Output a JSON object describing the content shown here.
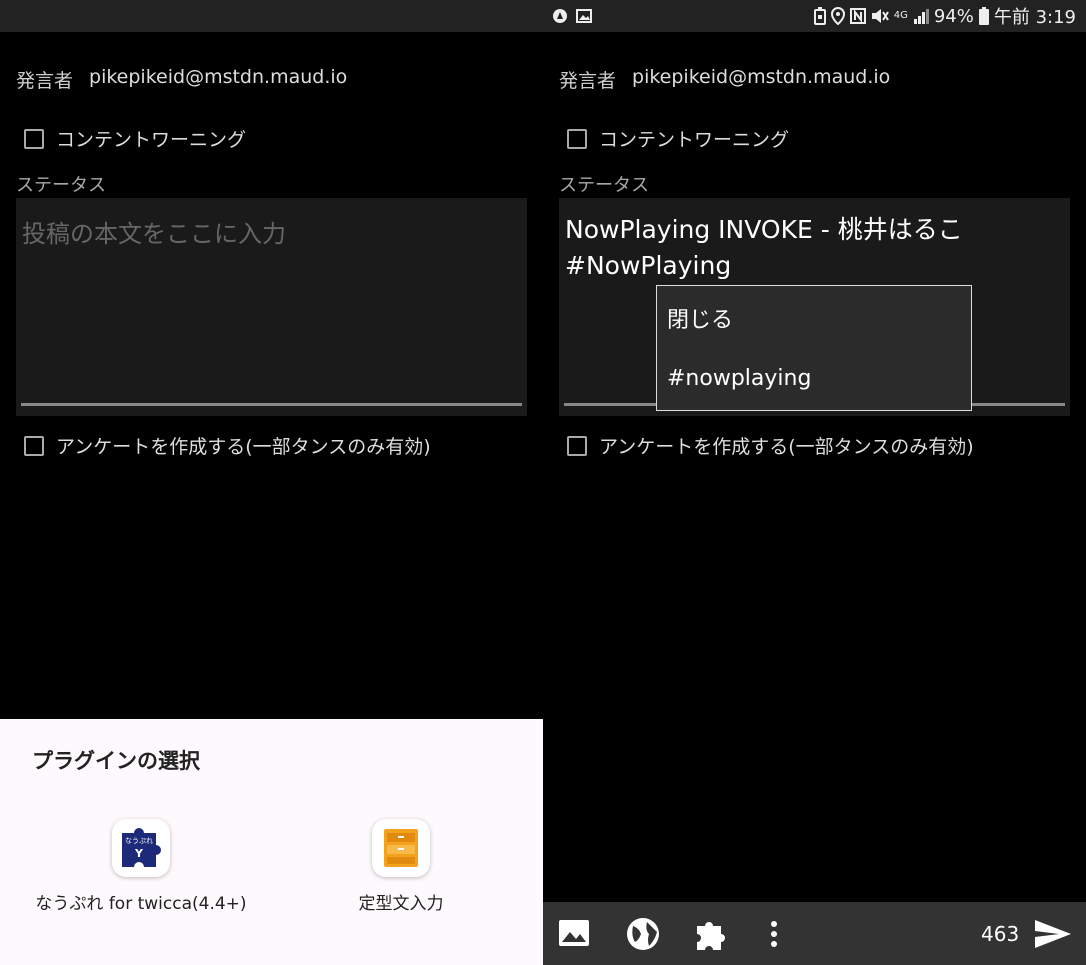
{
  "left": {
    "speaker_label": "発言者",
    "speaker_account": "pikepikeid@mstdn.maud.io",
    "cw_label": "コンテントワーニング",
    "status_label": "ステータス",
    "status_placeholder": "投稿の本文をここに入力",
    "poll_label": "アンケートを作成する(一部タンスのみ有効)",
    "plugin_sheet": {
      "title": "プラグインの選択",
      "plugins": [
        {
          "label": "なうぷれ for twicca(4.4+)",
          "icon": "nowplaying-puzzle-icon",
          "icon_text": "なうぷれ"
        },
        {
          "label": "定型文入力",
          "icon": "drawer-icon"
        }
      ]
    }
  },
  "right": {
    "statusbar": {
      "battery": "94%",
      "time": "午前 3:19",
      "network": "4G",
      "icons": [
        "app-notification-icon",
        "image-notification-icon",
        "battery-saver-icon",
        "location-icon",
        "nfc-icon",
        "mute-icon",
        "signal-icon",
        "battery-icon"
      ]
    },
    "speaker_label": "発言者",
    "speaker_account": "pikepikeid@mstdn.maud.io",
    "cw_label": "コンテントワーニング",
    "status_label": "ステータス",
    "status_text_line1": "NowPlaying INVOKE - 桃井はるこ",
    "status_text_line2": "#NowPlaying",
    "popup": {
      "items": [
        "閉じる",
        "#nowplaying"
      ]
    },
    "poll_label": "アンケートを作成する(一部タンスのみ有効)",
    "bottom_bar": {
      "char_count": "463",
      "icons": [
        "image-icon",
        "globe-icon",
        "plugin-icon",
        "more-vert-icon",
        "send-icon"
      ]
    }
  },
  "colors": {
    "background": "#000000",
    "input_bg": "#1a1a1a",
    "sheet_bg": "#fdf9fc",
    "bar_bg": "#333333"
  }
}
